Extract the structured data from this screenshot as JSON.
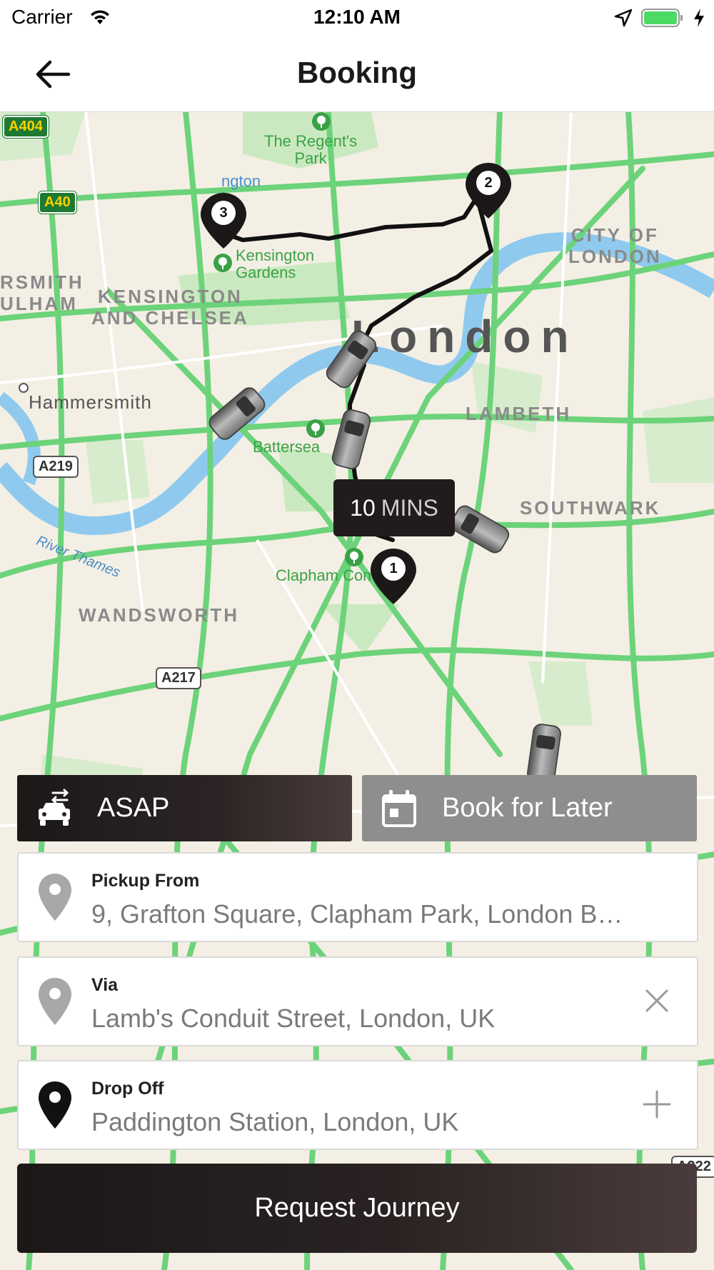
{
  "status_bar": {
    "carrier": "Carrier",
    "time": "12:10 AM",
    "wifi_icon": "wifi-icon",
    "location_icon": "location-arrow-icon",
    "battery_icon": "battery-charging-icon"
  },
  "nav": {
    "title": "Booking",
    "back_icon": "arrow-left-icon"
  },
  "map": {
    "areas": {
      "city_of_london": "CITY OF\nLONDON",
      "london": "London",
      "kensington": "KENSINGTON\nAND CHELSEA",
      "lambeth": "LAMBETH",
      "southwark": "SOUTHWARK",
      "wandsworth": "WANDSWORTH",
      "hammersmith": "Hammersmith",
      "fulham": "RSMITH\nULHAM"
    },
    "parks": {
      "regents": "The Regent's\nPark",
      "kensington_gardens": "Kensington\nGardens",
      "battersea": "Battersea",
      "clapham": "Clapham Common",
      "paddington": "ngton\nin"
    },
    "river": "River Thames",
    "roads": [
      "A404",
      "A40",
      "A219",
      "A217",
      "A222"
    ],
    "eta": {
      "value": "10",
      "unit": "MINS"
    },
    "pins": [
      "1",
      "2",
      "3"
    ],
    "colors": {
      "route": "#111111",
      "roads": "#6cd37a",
      "water": "#8fcaee",
      "land": "#f4efe4",
      "park": "#cbe9c0"
    }
  },
  "booking_mode": {
    "asap_label": "ASAP",
    "asap_icon": "taxi-swap-icon",
    "later_label": "Book for Later",
    "later_icon": "calendar-icon"
  },
  "fields": {
    "pickup": {
      "label": "Pickup From",
      "value": "9, Grafton Square, Clapham Park, London B…",
      "icon": "map-pin-gray-icon"
    },
    "via": {
      "label": "Via",
      "value": "Lamb's Conduit Street, London, UK",
      "icon": "map-pin-gray-icon",
      "action_icon": "close-icon"
    },
    "dropoff": {
      "label": "Drop Off",
      "value": "Paddington Station, London, UK",
      "icon": "map-pin-black-icon",
      "action_icon": "plus-icon"
    }
  },
  "actions": {
    "request_label": "Request Journey"
  },
  "colors": {
    "dark": "#211b1b",
    "gray_button": "#8e8e8e",
    "white": "#ffffff"
  }
}
